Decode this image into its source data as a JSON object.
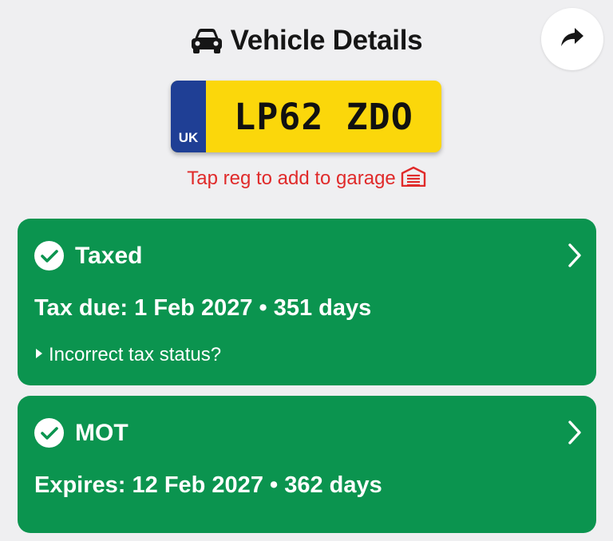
{
  "header": {
    "title": "Vehicle Details",
    "title_icon": "car-icon",
    "share_icon": "share-icon"
  },
  "plate": {
    "country": "UK",
    "registration": "LP62 ZDO",
    "band_color": "#1f3f95",
    "plate_color": "#fbd70b"
  },
  "garage_hint": {
    "label": "Tap reg to add to garage",
    "icon": "garage-icon",
    "color": "#e02a2a"
  },
  "tax_card": {
    "status": "Taxed",
    "due_text": "Tax due: 1 Feb 2027 • 351 days",
    "incorrect_link": "Incorrect tax status?",
    "color": "#0b944f"
  },
  "mot_card": {
    "status": "MOT",
    "due_text": "Expires: 12 Feb 2027 • 362 days",
    "color": "#0b944f"
  }
}
